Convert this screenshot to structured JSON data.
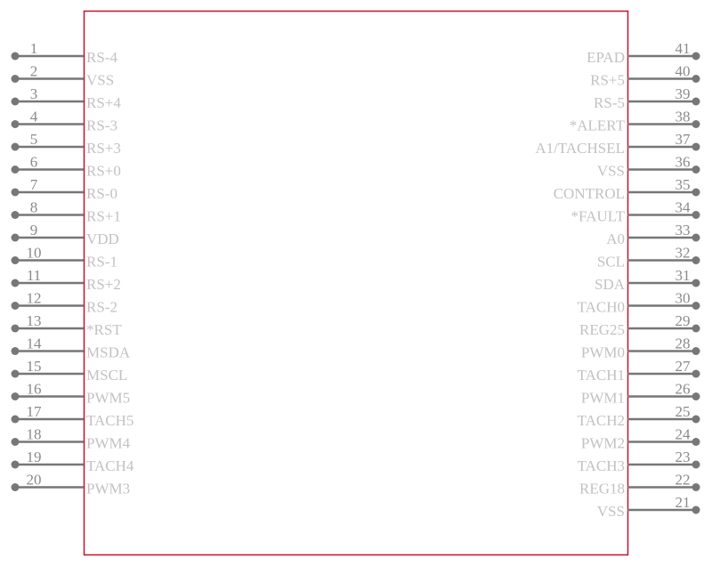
{
  "colors": {
    "outline": "#c8102e",
    "pin": "#777777",
    "label": "#c2c2c2",
    "number": "#8a8a8a"
  },
  "left_pins": [
    {
      "num": "1",
      "name": "RS-4"
    },
    {
      "num": "2",
      "name": "VSS"
    },
    {
      "num": "3",
      "name": "RS+4"
    },
    {
      "num": "4",
      "name": "RS-3"
    },
    {
      "num": "5",
      "name": "RS+3"
    },
    {
      "num": "6",
      "name": "RS+0"
    },
    {
      "num": "7",
      "name": "RS-0"
    },
    {
      "num": "8",
      "name": "RS+1"
    },
    {
      "num": "9",
      "name": "VDD"
    },
    {
      "num": "10",
      "name": "RS-1"
    },
    {
      "num": "11",
      "name": "RS+2"
    },
    {
      "num": "12",
      "name": "RS-2"
    },
    {
      "num": "13",
      "name": "*RST"
    },
    {
      "num": "14",
      "name": "MSDA"
    },
    {
      "num": "15",
      "name": "MSCL"
    },
    {
      "num": "16",
      "name": "PWM5"
    },
    {
      "num": "17",
      "name": "TACH5"
    },
    {
      "num": "18",
      "name": "PWM4"
    },
    {
      "num": "19",
      "name": "TACH4"
    },
    {
      "num": "20",
      "name": "PWM3"
    }
  ],
  "right_pins": [
    {
      "num": "41",
      "name": "EPAD"
    },
    {
      "num": "40",
      "name": "RS+5"
    },
    {
      "num": "39",
      "name": "RS-5"
    },
    {
      "num": "38",
      "name": "*ALERT"
    },
    {
      "num": "37",
      "name": "A1/TACHSEL"
    },
    {
      "num": "36",
      "name": "VSS"
    },
    {
      "num": "35",
      "name": "CONTROL"
    },
    {
      "num": "34",
      "name": "*FAULT"
    },
    {
      "num": "33",
      "name": "A0"
    },
    {
      "num": "32",
      "name": "SCL"
    },
    {
      "num": "31",
      "name": "SDA"
    },
    {
      "num": "30",
      "name": "TACH0"
    },
    {
      "num": "29",
      "name": "REG25"
    },
    {
      "num": "28",
      "name": "PWM0"
    },
    {
      "num": "27",
      "name": "TACH1"
    },
    {
      "num": "26",
      "name": "PWM1"
    },
    {
      "num": "25",
      "name": "TACH2"
    },
    {
      "num": "24",
      "name": "PWM2"
    },
    {
      "num": "23",
      "name": "TACH3"
    },
    {
      "num": "22",
      "name": "REG18"
    },
    {
      "num": "21",
      "name": "VSS"
    }
  ]
}
